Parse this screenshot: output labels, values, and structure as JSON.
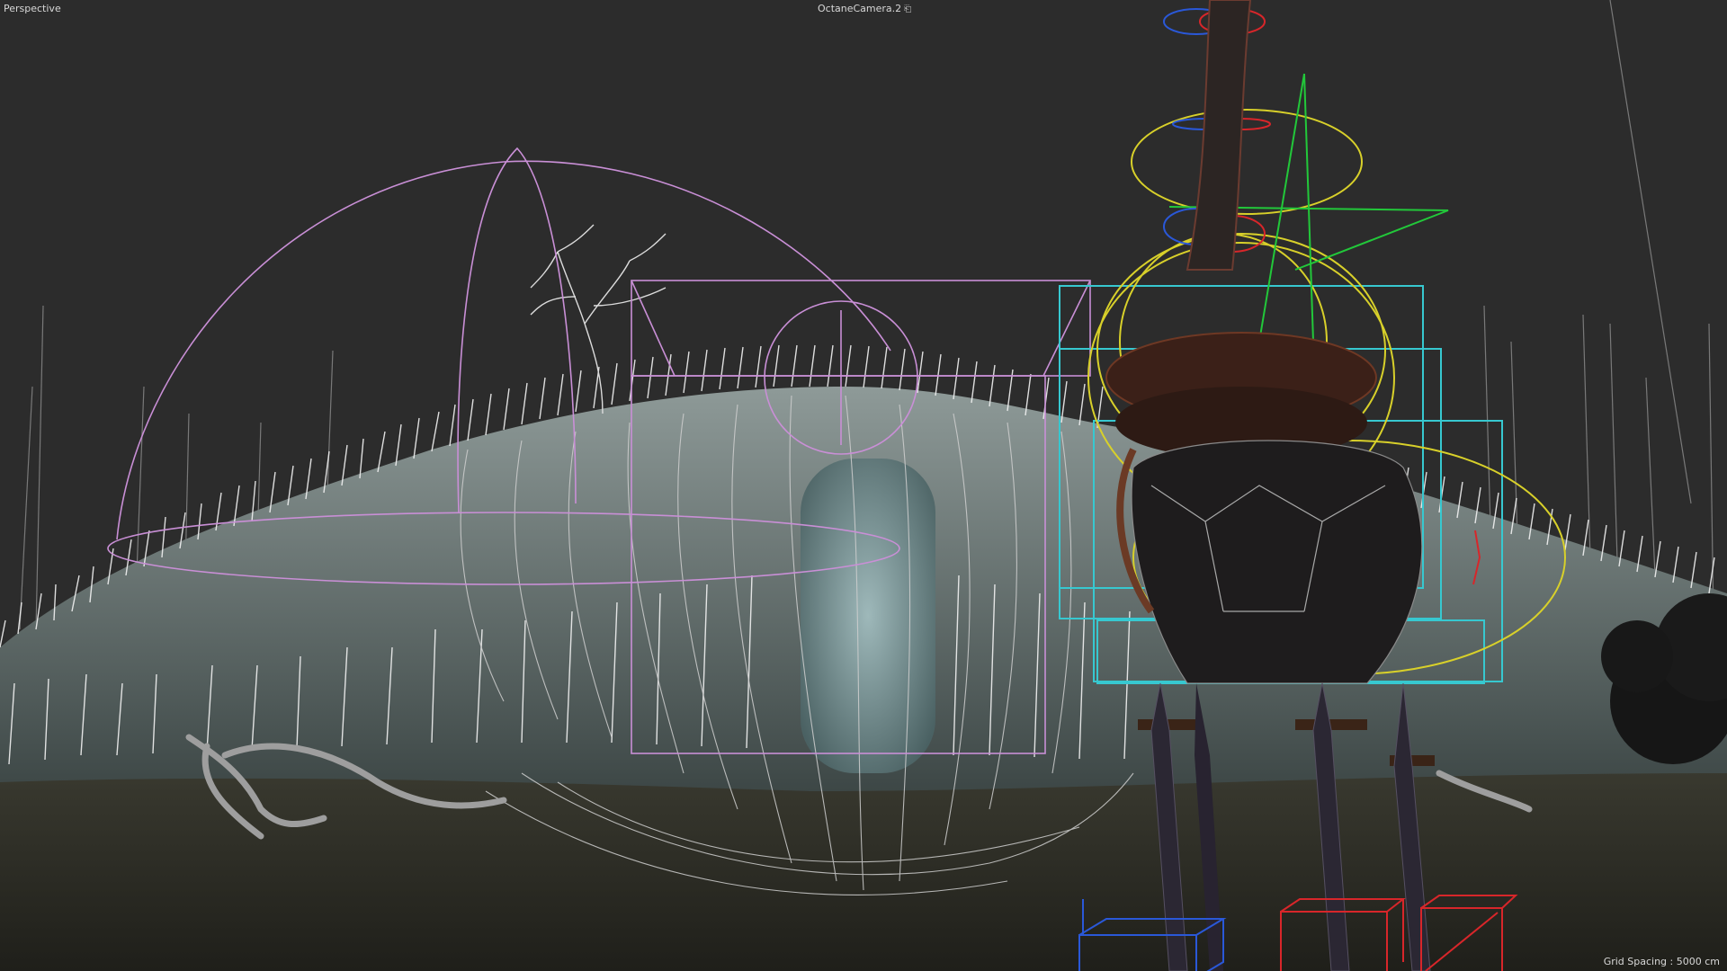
{
  "viewport": {
    "view_name": "Perspective",
    "camera_name": "OctaneCamera.2",
    "camera_icon": "camera-lock-icon",
    "grid_spacing": "Grid Spacing : 5000 cm"
  },
  "colors": {
    "background": "#2c2c2c",
    "ground": "#26261f",
    "grass": "#f2f2f2",
    "light_gizmo": "#c98fd6",
    "bounding_box": "#37c8d0",
    "spline_yellow": "#d8d02a",
    "spline_green": "#22c83a",
    "axis_red": "#d8262a",
    "axis_blue": "#2a58d8",
    "hud_text": "#d8d8d8"
  }
}
